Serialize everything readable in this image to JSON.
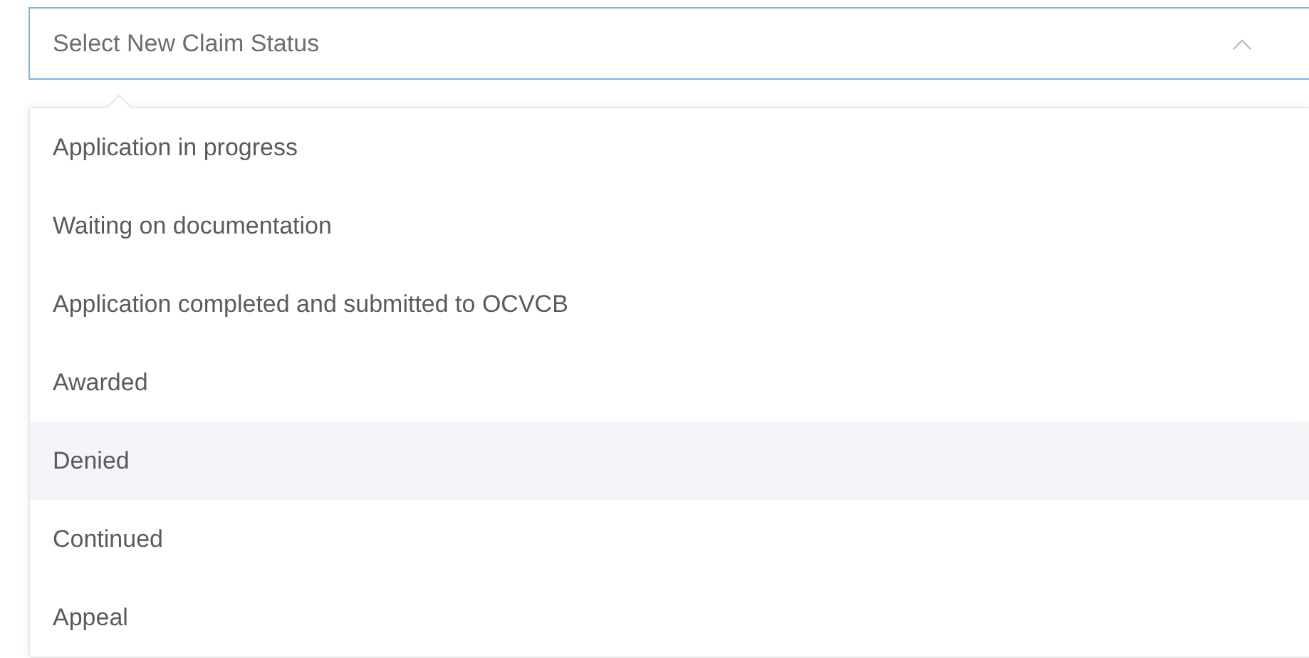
{
  "select": {
    "placeholder": "Select New Claim Status",
    "expanded": true
  },
  "options": [
    {
      "label": "Application in progress",
      "selected": false
    },
    {
      "label": "Waiting on documentation",
      "selected": false
    },
    {
      "label": "Application completed and submitted to OCVCB",
      "selected": false
    },
    {
      "label": "Awarded",
      "selected": false
    },
    {
      "label": "Denied",
      "selected": true
    },
    {
      "label": "Continued",
      "selected": false
    },
    {
      "label": "Appeal",
      "selected": false
    }
  ]
}
